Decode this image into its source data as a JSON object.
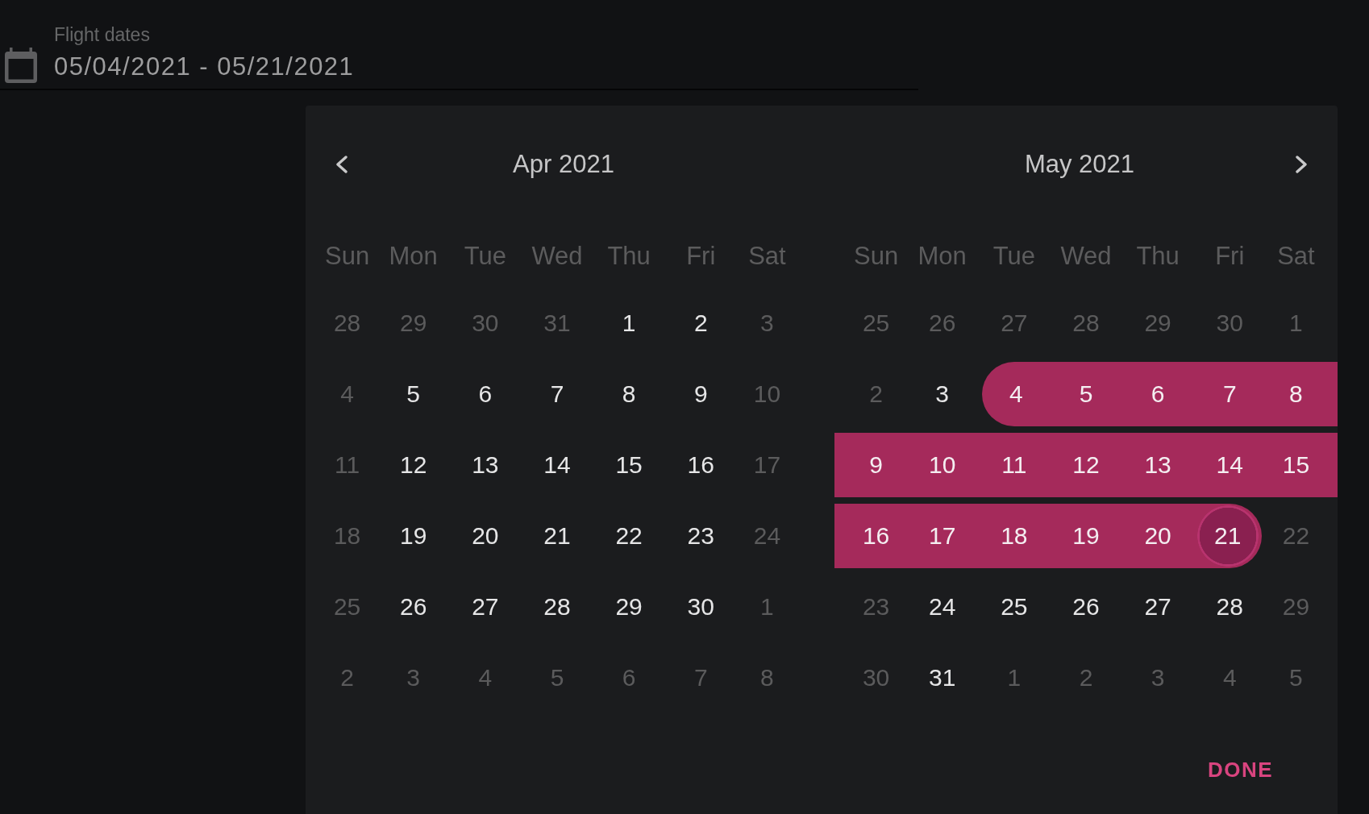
{
  "field": {
    "label": "Flight dates",
    "value": "05/04/2021 - 05/21/2021"
  },
  "picker": {
    "months": [
      {
        "title": "Apr 2021",
        "weekdays": [
          "Sun",
          "Mon",
          "Tue",
          "Wed",
          "Thu",
          "Fri",
          "Sat"
        ],
        "weeks": [
          [
            {
              "label": "28",
              "disabled": true,
              "selected": false,
              "focused": false
            },
            {
              "label": "29",
              "disabled": true,
              "selected": false,
              "focused": false
            },
            {
              "label": "30",
              "disabled": true,
              "selected": false,
              "focused": false
            },
            {
              "label": "31",
              "disabled": true,
              "selected": false,
              "focused": false
            },
            {
              "label": "1",
              "disabled": false,
              "selected": false,
              "focused": false
            },
            {
              "label": "2",
              "disabled": false,
              "selected": false,
              "focused": false
            },
            {
              "label": "3",
              "disabled": true,
              "selected": false,
              "focused": false
            }
          ],
          [
            {
              "label": "4",
              "disabled": true,
              "selected": false,
              "focused": false
            },
            {
              "label": "5",
              "disabled": false,
              "selected": false,
              "focused": false
            },
            {
              "label": "6",
              "disabled": false,
              "selected": false,
              "focused": false
            },
            {
              "label": "7",
              "disabled": false,
              "selected": false,
              "focused": false
            },
            {
              "label": "8",
              "disabled": false,
              "selected": false,
              "focused": false
            },
            {
              "label": "9",
              "disabled": false,
              "selected": false,
              "focused": false
            },
            {
              "label": "10",
              "disabled": true,
              "selected": false,
              "focused": false
            }
          ],
          [
            {
              "label": "11",
              "disabled": true,
              "selected": false,
              "focused": false
            },
            {
              "label": "12",
              "disabled": false,
              "selected": false,
              "focused": false
            },
            {
              "label": "13",
              "disabled": false,
              "selected": false,
              "focused": false
            },
            {
              "label": "14",
              "disabled": false,
              "selected": false,
              "focused": false
            },
            {
              "label": "15",
              "disabled": false,
              "selected": false,
              "focused": false
            },
            {
              "label": "16",
              "disabled": false,
              "selected": false,
              "focused": false
            },
            {
              "label": "17",
              "disabled": true,
              "selected": false,
              "focused": false
            }
          ],
          [
            {
              "label": "18",
              "disabled": true,
              "selected": false,
              "focused": false
            },
            {
              "label": "19",
              "disabled": false,
              "selected": false,
              "focused": false
            },
            {
              "label": "20",
              "disabled": false,
              "selected": false,
              "focused": false
            },
            {
              "label": "21",
              "disabled": false,
              "selected": false,
              "focused": false
            },
            {
              "label": "22",
              "disabled": false,
              "selected": false,
              "focused": false
            },
            {
              "label": "23",
              "disabled": false,
              "selected": false,
              "focused": false
            },
            {
              "label": "24",
              "disabled": true,
              "selected": false,
              "focused": false
            }
          ],
          [
            {
              "label": "25",
              "disabled": true,
              "selected": false,
              "focused": false
            },
            {
              "label": "26",
              "disabled": false,
              "selected": false,
              "focused": false
            },
            {
              "label": "27",
              "disabled": false,
              "selected": false,
              "focused": false
            },
            {
              "label": "28",
              "disabled": false,
              "selected": false,
              "focused": false
            },
            {
              "label": "29",
              "disabled": false,
              "selected": false,
              "focused": false
            },
            {
              "label": "30",
              "disabled": false,
              "selected": false,
              "focused": false
            },
            {
              "label": "1",
              "disabled": true,
              "selected": false,
              "focused": false
            }
          ],
          [
            {
              "label": "2",
              "disabled": true,
              "selected": false,
              "focused": false
            },
            {
              "label": "3",
              "disabled": true,
              "selected": false,
              "focused": false
            },
            {
              "label": "4",
              "disabled": true,
              "selected": false,
              "focused": false
            },
            {
              "label": "5",
              "disabled": true,
              "selected": false,
              "focused": false
            },
            {
              "label": "6",
              "disabled": true,
              "selected": false,
              "focused": false
            },
            {
              "label": "7",
              "disabled": true,
              "selected": false,
              "focused": false
            },
            {
              "label": "8",
              "disabled": true,
              "selected": false,
              "focused": false
            }
          ]
        ]
      },
      {
        "title": "May 2021",
        "weekdays": [
          "Sun",
          "Mon",
          "Tue",
          "Wed",
          "Thu",
          "Fri",
          "Sat"
        ],
        "weeks": [
          [
            {
              "label": "25",
              "disabled": true,
              "selected": false,
              "focused": false
            },
            {
              "label": "26",
              "disabled": true,
              "selected": false,
              "focused": false
            },
            {
              "label": "27",
              "disabled": true,
              "selected": false,
              "focused": false
            },
            {
              "label": "28",
              "disabled": true,
              "selected": false,
              "focused": false
            },
            {
              "label": "29",
              "disabled": true,
              "selected": false,
              "focused": false
            },
            {
              "label": "30",
              "disabled": true,
              "selected": false,
              "focused": false
            },
            {
              "label": "1",
              "disabled": true,
              "selected": false,
              "focused": false
            }
          ],
          [
            {
              "label": "2",
              "disabled": true,
              "selected": false,
              "focused": false
            },
            {
              "label": "3",
              "disabled": false,
              "selected": false,
              "focused": false
            },
            {
              "label": "4",
              "disabled": false,
              "selected": true,
              "focused": false
            },
            {
              "label": "5",
              "disabled": false,
              "selected": true,
              "focused": false
            },
            {
              "label": "6",
              "disabled": false,
              "selected": true,
              "focused": false
            },
            {
              "label": "7",
              "disabled": false,
              "selected": true,
              "focused": false
            },
            {
              "label": "8",
              "disabled": false,
              "selected": true,
              "focused": false
            }
          ],
          [
            {
              "label": "9",
              "disabled": false,
              "selected": true,
              "focused": false
            },
            {
              "label": "10",
              "disabled": false,
              "selected": true,
              "focused": false
            },
            {
              "label": "11",
              "disabled": false,
              "selected": true,
              "focused": false
            },
            {
              "label": "12",
              "disabled": false,
              "selected": true,
              "focused": false
            },
            {
              "label": "13",
              "disabled": false,
              "selected": true,
              "focused": false
            },
            {
              "label": "14",
              "disabled": false,
              "selected": true,
              "focused": false
            },
            {
              "label": "15",
              "disabled": false,
              "selected": true,
              "focused": false
            }
          ],
          [
            {
              "label": "16",
              "disabled": false,
              "selected": true,
              "focused": false
            },
            {
              "label": "17",
              "disabled": false,
              "selected": true,
              "focused": false
            },
            {
              "label": "18",
              "disabled": false,
              "selected": true,
              "focused": false
            },
            {
              "label": "19",
              "disabled": false,
              "selected": true,
              "focused": false
            },
            {
              "label": "20",
              "disabled": false,
              "selected": true,
              "focused": false
            },
            {
              "label": "21",
              "disabled": false,
              "selected": true,
              "focused": true
            },
            {
              "label": "22",
              "disabled": true,
              "selected": false,
              "focused": false
            }
          ],
          [
            {
              "label": "23",
              "disabled": true,
              "selected": false,
              "focused": false
            },
            {
              "label": "24",
              "disabled": false,
              "selected": false,
              "focused": false
            },
            {
              "label": "25",
              "disabled": false,
              "selected": false,
              "focused": false
            },
            {
              "label": "26",
              "disabled": false,
              "selected": false,
              "focused": false
            },
            {
              "label": "27",
              "disabled": false,
              "selected": false,
              "focused": false
            },
            {
              "label": "28",
              "disabled": false,
              "selected": false,
              "focused": false
            },
            {
              "label": "29",
              "disabled": true,
              "selected": false,
              "focused": false
            }
          ],
          [
            {
              "label": "30",
              "disabled": true,
              "selected": false,
              "focused": false
            },
            {
              "label": "31",
              "disabled": false,
              "selected": false,
              "focused": false
            },
            {
              "label": "1",
              "disabled": true,
              "selected": false,
              "focused": false
            },
            {
              "label": "2",
              "disabled": true,
              "selected": false,
              "focused": false
            },
            {
              "label": "3",
              "disabled": true,
              "selected": false,
              "focused": false
            },
            {
              "label": "4",
              "disabled": true,
              "selected": false,
              "focused": false
            },
            {
              "label": "5",
              "disabled": true,
              "selected": false,
              "focused": false
            }
          ]
        ]
      }
    ],
    "done_button": "DONE"
  }
}
